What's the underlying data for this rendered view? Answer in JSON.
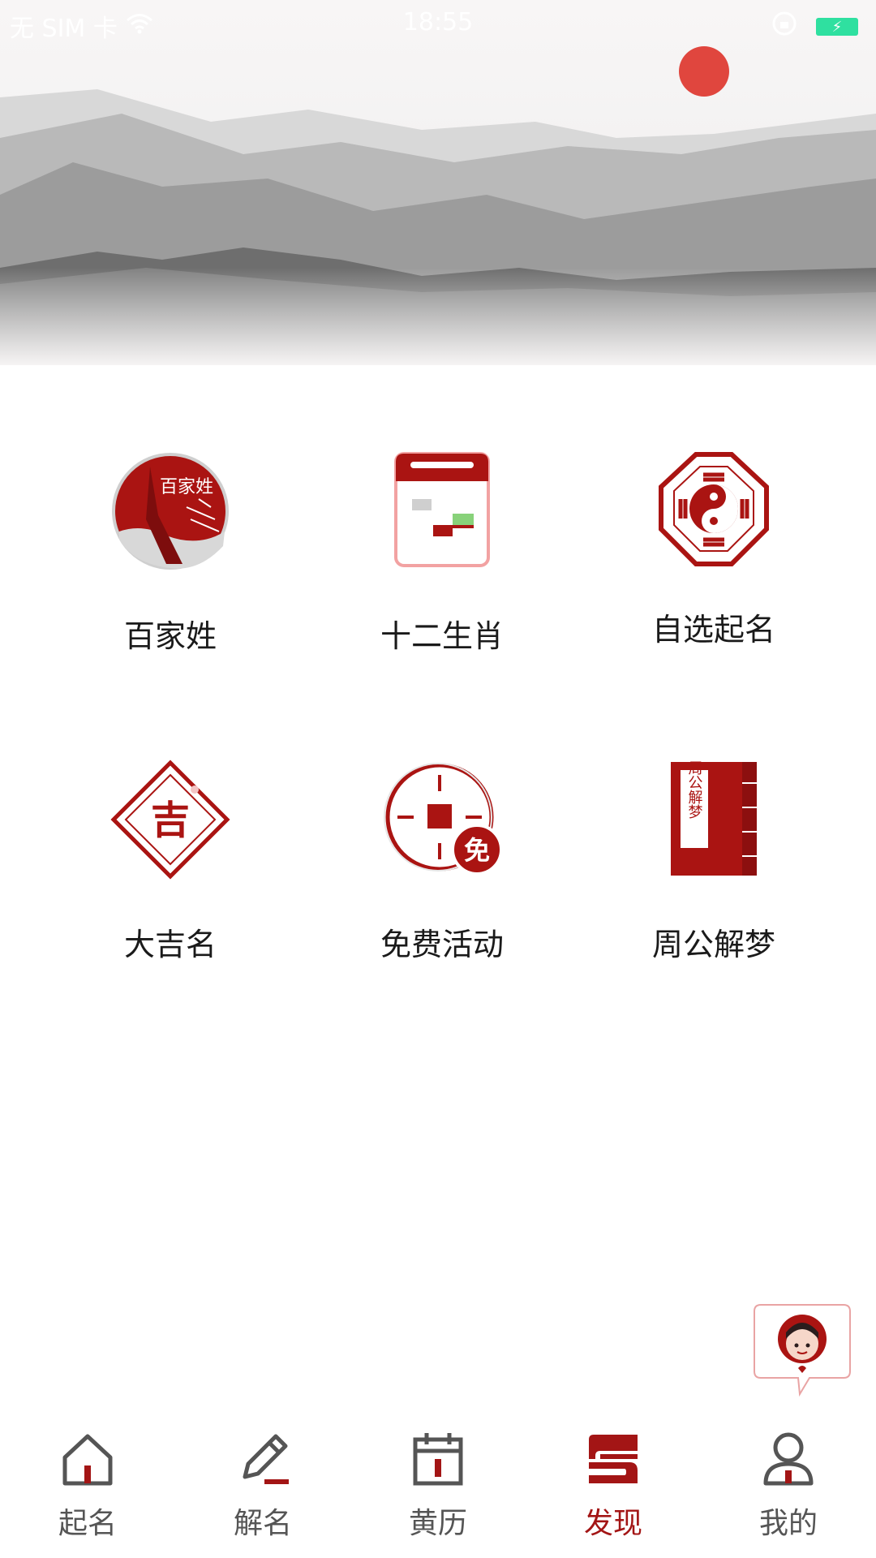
{
  "status_bar": {
    "carrier": "无 SIM 卡",
    "time": "18:55"
  },
  "grid": {
    "items": [
      {
        "label": "百家姓",
        "icon": "surname-icon",
        "icon_text": "百家姓"
      },
      {
        "label": "十二生肖",
        "icon": "calendar-icon"
      },
      {
        "label": "自选起名",
        "icon": "bagua-icon"
      },
      {
        "label": "大吉名",
        "icon": "lucky-diamond-icon",
        "icon_text": "吉"
      },
      {
        "label": "免费活动",
        "icon": "coin-free-icon",
        "icon_text": "免"
      },
      {
        "label": "周公解梦",
        "icon": "dream-book-icon",
        "icon_text": "周公解梦"
      }
    ]
  },
  "tabbar": {
    "tabs": [
      {
        "label": "起名",
        "icon": "home-icon",
        "active": false
      },
      {
        "label": "解名",
        "icon": "pencil-icon",
        "active": false
      },
      {
        "label": "黄历",
        "icon": "calendar-tab-icon",
        "active": false
      },
      {
        "label": "发现",
        "icon": "discover-icon",
        "active": true
      },
      {
        "label": "我的",
        "icon": "profile-icon",
        "active": false
      }
    ]
  },
  "colors": {
    "accent": "#a31515",
    "inactive": "#555555"
  }
}
